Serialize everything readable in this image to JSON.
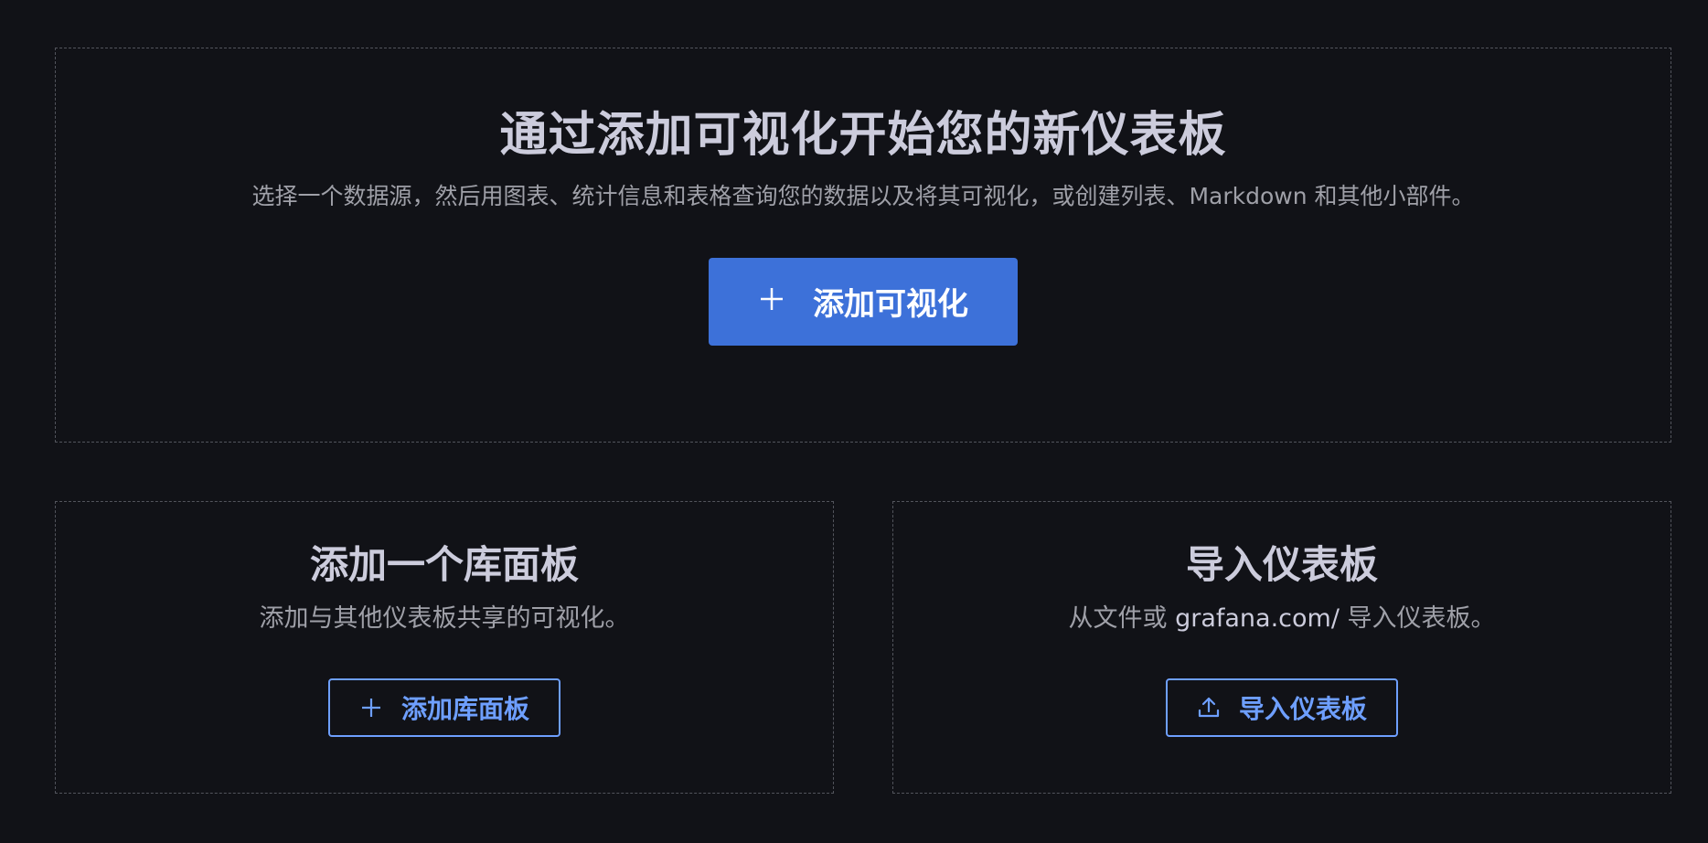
{
  "hero": {
    "title": "通过添加可视化开始您的新仪表板",
    "subtitle": "选择一个数据源，然后用图表、统计信息和表格查询您的数据以及将其可视化，或创建列表、Markdown 和其他小部件。",
    "add_visualization_label": "添加可视化",
    "add_icon": "plus-icon"
  },
  "library_panel": {
    "title": "添加一个库面板",
    "subtitle": "添加与其他仪表板共享的可视化。",
    "button_label": "添加库面板",
    "button_icon": "plus-icon"
  },
  "import_dashboard": {
    "title": "导入仪表板",
    "subtitle_prefix": "从文件或 ",
    "subtitle_link": "grafana.com/",
    "subtitle_suffix": " 导入仪表板。",
    "button_label": "导入仪表板",
    "button_icon": "upload-icon"
  },
  "colors": {
    "background": "#111217",
    "primary": "#3d71d9",
    "secondary_text": "#6e9fff",
    "border": "#52545c"
  }
}
